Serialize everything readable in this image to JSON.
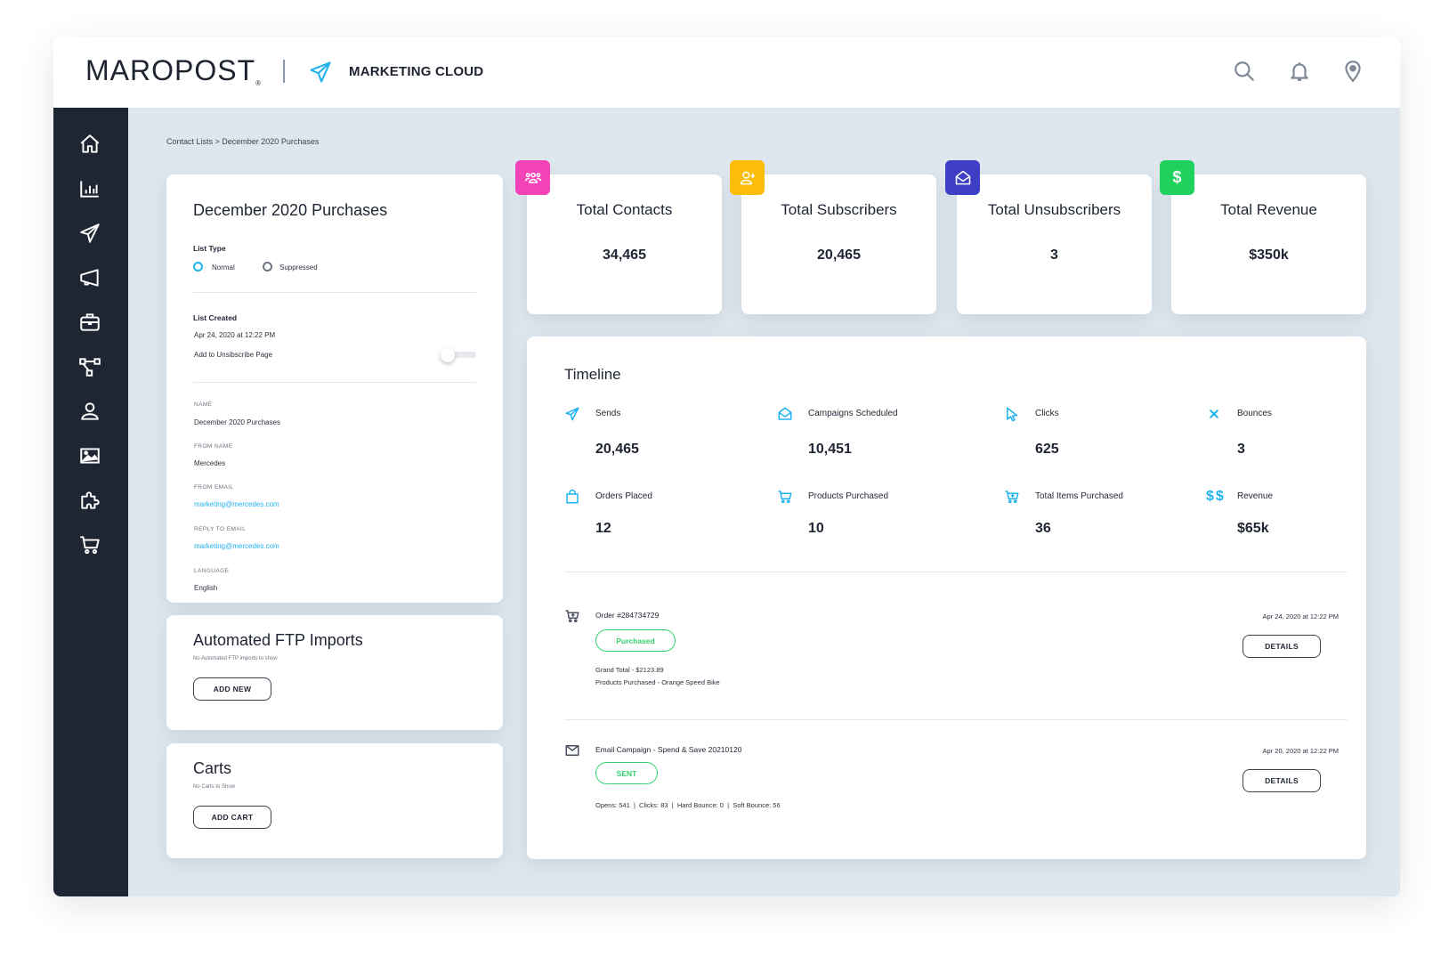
{
  "header": {
    "logo": "MAROPOST",
    "product": "MARKETING CLOUD",
    "icons": [
      "search-icon",
      "bell-icon",
      "location-pin-icon"
    ]
  },
  "sidebar": {
    "items": [
      {
        "name": "home",
        "icon": "home-icon"
      },
      {
        "name": "analytics",
        "icon": "bar-chart-icon"
      },
      {
        "name": "campaigns",
        "icon": "paper-plane-icon"
      },
      {
        "name": "announcements",
        "icon": "megaphone-icon"
      },
      {
        "name": "briefcase",
        "icon": "briefcase-icon"
      },
      {
        "name": "journeys",
        "icon": "workflow-icon"
      },
      {
        "name": "contacts",
        "icon": "user-icon"
      },
      {
        "name": "media",
        "icon": "image-icon"
      },
      {
        "name": "integrations",
        "icon": "puzzle-icon"
      },
      {
        "name": "commerce",
        "icon": "cart-icon"
      }
    ]
  },
  "breadcrumb": "Contact Lists > December 2020 Purchases",
  "details": {
    "title": "December 2020 Purchases",
    "list_type_label": "List Type",
    "list_type_options": [
      "Normal",
      "Suppressed"
    ],
    "list_type_selected": "Normal",
    "list_created_label": "List Created",
    "list_created_value": "Apr 24, 2020 at 12:22 PM",
    "unsubscribe_label": "Add to Unsibscribe Page",
    "unsubscribe_enabled": false,
    "fields": [
      {
        "label": "NAME",
        "value": "December 2020 Purchases",
        "link": false
      },
      {
        "label": "FROM NAME",
        "value": "Mercedes",
        "link": false
      },
      {
        "label": "FROM EMAIL",
        "value": "marketing@mercedes.com",
        "link": true
      },
      {
        "label": "REPLY TO EMAIL",
        "value": "marketing@mercedes.com",
        "link": true
      },
      {
        "label": "LANGUAGE",
        "value": "English",
        "link": false
      }
    ]
  },
  "ftp": {
    "title": "Automated FTP Imports",
    "empty_text": "No Automated FTP imports to show",
    "button": "ADD NEW"
  },
  "carts": {
    "title": "Carts",
    "empty_text": "No Carts to Show",
    "button": "ADD CART"
  },
  "stats": [
    {
      "title": "Total Contacts",
      "value": "34,465",
      "icon": "users-icon",
      "color": "#f542b9"
    },
    {
      "title": "Total Subscribers",
      "value": "20,465",
      "icon": "user-plus-icon",
      "color": "#fbbd08"
    },
    {
      "title": "Total Unsubscribers",
      "value": "3",
      "icon": "open-envelope-icon",
      "color": "#3f3fc6"
    },
    {
      "title": "Total Revenue",
      "value": "$350k",
      "icon": "dollar-icon",
      "color": "#1fd25e"
    }
  ],
  "timeline": {
    "title": "Timeline",
    "accent": "#1eb3f0",
    "metrics": [
      {
        "label": "Sends",
        "value": "20,465",
        "icon": "paper-plane-icon"
      },
      {
        "label": "Campaigns Scheduled",
        "value": "10,451",
        "icon": "open-envelope-icon"
      },
      {
        "label": "Clicks",
        "value": "625",
        "icon": "cursor-icon"
      },
      {
        "label": "Bounces",
        "value": "3",
        "icon": "x-icon"
      },
      {
        "label": "Orders Placed",
        "value": "12",
        "icon": "shopping-bag-icon"
      },
      {
        "label": "Products Purchased",
        "value": "10",
        "icon": "cart-icon"
      },
      {
        "label": "Total Items Purchased",
        "value": "36",
        "icon": "cart-plus-icon"
      },
      {
        "label": "Revenue",
        "value": "$65k",
        "icon": "double-dollar-icon"
      }
    ],
    "events": [
      {
        "icon": "cart-plus-icon",
        "title": "Order #284734729",
        "status": "Purchased",
        "lines": [
          "Grand Total - $2123.89",
          "Products Purchased - Orange Speed Bike"
        ],
        "date": "Apr 24, 2020 at 12:22 PM",
        "button": "DETAILS"
      },
      {
        "icon": "envelope-icon",
        "title": "Email Campaign - Spend & Save 20210120",
        "status": "SENT",
        "lines": [
          "Opens: 541  |  Clicks: 83  |  Hard Bounce: 0  |  Soft Bounce: 56"
        ],
        "date": "Apr 20, 2020 at 12:22 PM",
        "button": "DETAILS"
      }
    ]
  }
}
